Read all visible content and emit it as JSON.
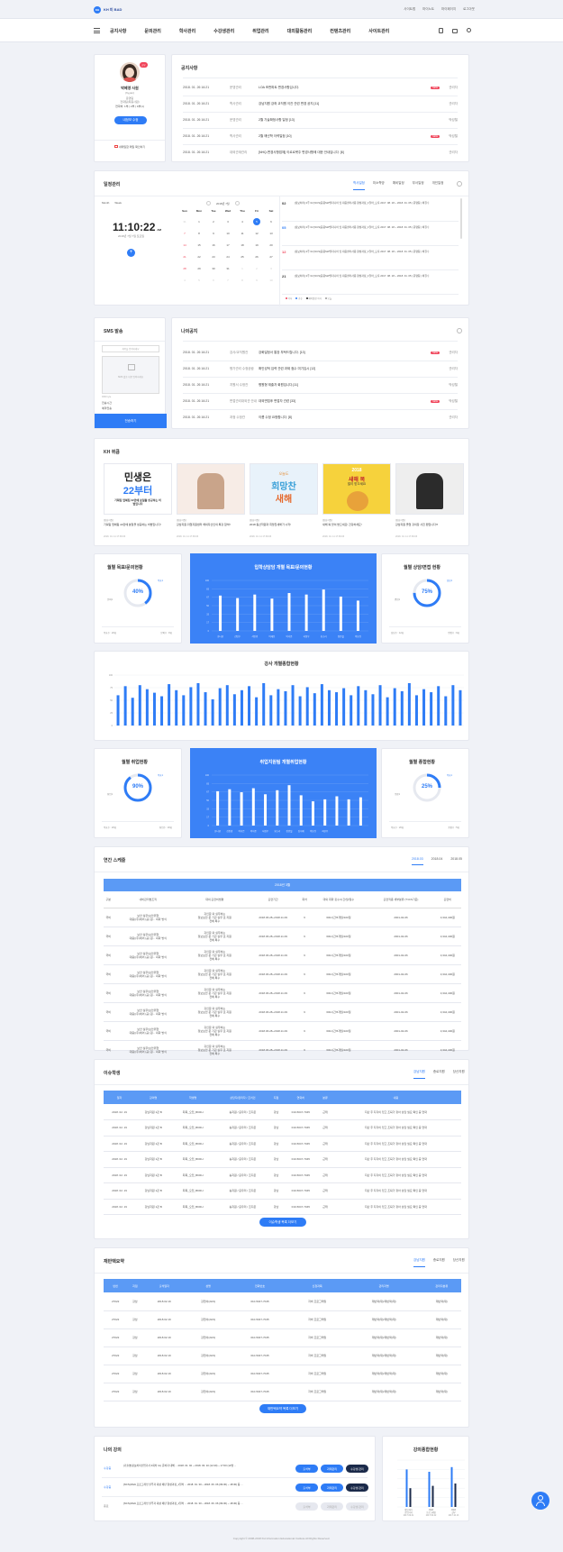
{
  "header": {
    "logo_mark": "KH",
    "logo_text": "KH 미 BAD",
    "links": [
      "사이트맵",
      "마이노트",
      "마이페이지",
      "로그아웃"
    ]
  },
  "nav": {
    "items": [
      "공지사항",
      "문의관리",
      "학사관리",
      "수강생관리",
      "취업관리",
      "대외활동관리",
      "컨텐츠관리",
      "사이트관리"
    ]
  },
  "profile": {
    "badge": "교무",
    "name": "박혜영 사원",
    "id": "(hyyan)",
    "dept": "운영팀",
    "sub": "전략팀(최종사원)",
    "phone": "연락처: 1부 | 2부 | 3부(1)",
    "button": "내정보 수정",
    "footer": "내메일함 메일 확인하기"
  },
  "notice": {
    "title": "공지사항",
    "rows": [
      {
        "date": "2018. 01. 26 16:21",
        "cat": "운영관리",
        "text": "LOA 조판파트 변경사항입니다.",
        "new": true,
        "by": "관리자"
      },
      {
        "date": "2018. 01. 26 16:21",
        "cat": "학사관리",
        "text": "강남지원 강좌 교직원 이관 관련 변경 공지 [11]",
        "new": false,
        "by": "관리자"
      },
      {
        "date": "2018. 01. 26 16:21",
        "cat": "운영관리",
        "text": "2월 기술확정사항 일정 [13]",
        "new": false,
        "by": "박성철"
      },
      {
        "date": "2018. 01. 26 16:21",
        "cat": "학사관리",
        "text": "2월 매년학 이력일정 [10]",
        "new": true,
        "by": "박성철"
      },
      {
        "date": "2018. 01. 26 16:21",
        "cat": "대외관계관리",
        "text": "[NHQ-변경사항업체] 이르르렛주 변경사항에 대한 안내입니다. [6]",
        "new": false,
        "by": "관리자"
      }
    ]
  },
  "schedule": {
    "title": "일정관리",
    "tabs": [
      "학사일정",
      "미소학방",
      "예비일정",
      "부서일정",
      "개인일정"
    ],
    "view_month": "Month",
    "view_week": "Week",
    "time": "11:10:22",
    "ampm": "AM",
    "date": "2018년 7월 7일 토요일",
    "month_label": "2018년 7월",
    "days": [
      "Sun",
      "Mon",
      "Tue",
      "Wed",
      "Thu",
      "Fri",
      "Sat"
    ],
    "cal": [
      [
        "",
        "1",
        "",
        "",
        "",
        "",
        ""
      ],
      [
        "",
        "",
        "",
        "",
        "",
        "",
        ""
      ]
    ],
    "events": [
      {
        "day": "02",
        "text": "[정보처리] 2주 02 [NCS]응용SW엔지니어 및 대응센터사용 양성과정_1일차_오후 2017. 08. 18 ~ 2018. 01. 05 | 운영팀 | 박길수"
      },
      {
        "day": "05",
        "text": "[정보처리] 2주 02 [NCS]응용SW엔지니어 및 대응센터사용 양성과정_1일차_오후 2017. 08. 18 ~ 2018. 01. 05 | 운영팀 | 박길수"
      },
      {
        "day": "12",
        "text": "[정보처리] 2주 02 [NCS]응용SW엔지니어 및 대응센터사용 양성과정_1일차_오후 2017. 08. 18 ~ 2018. 01. 05 | 운영팀 | 박길수"
      },
      {
        "day": "21",
        "text": "[정보처리] 2주 02 [NCS]응용SW엔지니어 및 대응센터사용 양성과정_1일차_오후 2017. 08. 18 ~ 2018. 01. 05 | 운영팀 | 박길수"
      }
    ],
    "legend": [
      "학사",
      "공휴",
      "예비일정 학사",
      "오늘"
    ]
  },
  "sms": {
    "title": "SMS 발송",
    "placeholder": "제목을 입력하세요",
    "body_hint": "SMS 발송 내용 입력하세요",
    "count": "0/80 byte",
    "option1": "전송시간",
    "option2": "예약전송",
    "button": "전송하기"
  },
  "mynotice": {
    "title": "나의공지",
    "rows": [
      {
        "date": "2018. 01. 26 16:21",
        "cat": "강사/교직원관",
        "text": "강화일정서 통장 부탁드립니다. [13]",
        "new": true,
        "by": "관리자"
      },
      {
        "date": "2018. 01. 26 16:21",
        "cat": "평가관리 수정공람",
        "text": "확인성적 입력 관련 과제 점수 미기입시 [12]",
        "new": false,
        "by": "관리자"
      },
      {
        "date": "2018. 01. 26 16:21",
        "cat": "지원서 수정관",
        "text": "병원형 재출자 회원입니다.[11]",
        "new": false,
        "by": "박성철"
      },
      {
        "date": "2018. 01. 26 16:21",
        "cat": "면접관리대외관 안내",
        "text": "대외면접후 면접자 관련 [33]",
        "new": true,
        "by": "박성철"
      },
      {
        "date": "2018. 01. 26 16:21",
        "cat": "과정 수정관",
        "text": "이름 수정 요청합니다. [8]",
        "new": false,
        "by": "관리자"
      }
    ]
  },
  "kh": {
    "title": "KH 퀴큼",
    "items": [
      {
        "img_line1": "민생은",
        "img_line2": "22부터",
        "img_sub": "기획팀 업체팀 22만에 분일들 성공하는 비법입니다",
        "cat": "[강남지원]",
        "text": "기획팀 업체팀 22만에 분일을 성공하는 비법입니다!",
        "date": "2018. 01. 11 17:36:03"
      },
      {
        "cat": "[강남지원]",
        "text": "강남지원 취업지원센터 해외자산인의 특강 참석!!",
        "date": "2018. 01. 11 17:36:03"
      },
      {
        "img_line1": "오늘도",
        "img_line2": "희망찬",
        "img_line3": "새해",
        "cat": "[강남지원]",
        "text": "2018 동산학원과 희망찬새해가 시작!",
        "date": "2018. 01. 11 17:36:03"
      },
      {
        "img_line1": "2018",
        "img_line2": "새해 복",
        "img_line3": "많이 받으세요",
        "cat": "[강남지원]",
        "text": "새해 복 많이 받으세요! 건강하세요!",
        "date": "2018. 01. 11 17:36:03"
      },
      {
        "cat": "[강남지원]",
        "text": "강남지원 졸업 강의장 사진 팬입니다!!!",
        "date": "2018. 01. 11 17:36:03"
      }
    ]
  },
  "stats1": {
    "left": {
      "title": "월별 목표/문의현황",
      "pct": 40,
      "pct_text": "40%",
      "a": "목표1",
      "b": "문의1",
      "foot_l": "목표수 : 20회",
      "foot_r": "문의수 : 8회"
    },
    "center": {
      "title": "입학상담담 개별 목표/문의현황",
      "cats": [
        "송나현",
        "김민수",
        "서민영",
        "이예진",
        "박서준",
        "허정우",
        "홍소리",
        "정민철",
        "이유진"
      ],
      "values": [
        70,
        65,
        72,
        64,
        75,
        72,
        82,
        68,
        60
      ]
    },
    "right": {
      "title": "월별 상담/면접 현황",
      "pct": 75,
      "pct_text": "75%",
      "a": "상담1",
      "b": "면접1",
      "foot_l": "상담수 : 12회",
      "foot_r": "면접수 : 9회"
    }
  },
  "teacher": {
    "title": "강사 개별종합현황",
    "values": [
      60,
      78,
      55,
      80,
      72,
      65,
      58,
      82,
      70,
      60,
      76,
      84,
      66,
      52,
      74,
      80,
      62,
      70,
      78,
      56,
      84,
      60,
      72,
      68,
      80,
      58,
      76,
      64,
      82,
      70,
      66,
      74,
      60,
      78,
      70,
      62,
      80,
      56,
      74,
      68,
      84,
      60,
      72,
      66,
      78,
      58,
      80,
      70
    ]
  },
  "stats2": {
    "left": {
      "title": "월별 취업현황",
      "pct": 90,
      "pct_text": "90%",
      "a": "목표1",
      "b": "취업1",
      "foot_l": "목표수 : 20회",
      "foot_r": "취업수 : 18회"
    },
    "center": {
      "title": "취업지원팀 개별취업현황",
      "cats": [
        "유나현",
        "김민경",
        "이지은",
        "박서준",
        "허정우",
        "홍소리",
        "정민철",
        "김지혜",
        "이유진",
        "최현우"
      ],
      "values": [
        68,
        72,
        66,
        74,
        62,
        70,
        80,
        60,
        48,
        52,
        58,
        52,
        56
      ]
    },
    "right": {
      "title": "월별 종합현황",
      "pct": 25,
      "pct_text": "25%",
      "a": "목표1",
      "b": "종합1",
      "foot_l": "목표수 : 20회",
      "foot_r": "종합수 : 5회"
    }
  },
  "yearly": {
    "title": "연간 스케줄",
    "tabs": [
      "2018.03",
      "2018.04",
      "2018.05"
    ],
    "band": "2018년 3월",
    "headers": [
      "구분",
      "내비관리법조직",
      "대외 훈련비법평",
      "훈련기간",
      "회차",
      "대외 회화 횟수/시간/월/일수",
      "훈련직종 세부분류 (*NCS기준)",
      "훈련비"
    ],
    "rows": [
      [
        "국비",
        "보안 실무(보안위협\n대응)(주)에어 (공) 원...  외화 방식",
        "귀인문 외 실무처는\n정보보안 문 기관 실무 로 지원\n전체 특수",
        "2018.06.28~2018.11.09",
        "6",
        "600시간/5개월/100일",
        "2001-02-06",
        "3,344,400원"
      ],
      [
        "국비",
        "보안 실무(보안위협\n대응)(주)에어 (공) 원...  외화 방식",
        "귀인문 외 실무처는\n정보보안 문 기관 실무 로 지원\n전체 특수",
        "2018.06.28~2018.11.09",
        "6",
        "600시간/5개월/100일",
        "2001-02-06",
        "3,344,400원"
      ],
      [
        "국비",
        "보안 실무(보안위협\n대응)(주)에어 (공) 원...  외화 방식",
        "귀인문 외 실무처는\n정보보안 문 기관 실무 로 지원\n전체 특수",
        "2018.06.28~2018.11.09",
        "6",
        "600시간/5개월/100일",
        "2001-02-06",
        "3,344,400원"
      ],
      [
        "국비",
        "보안 실무(보안위협\n대응)(주)에어 (공) 원...  외화 방식",
        "귀인문 외 실무처는\n정보보안 문 기관 실무 로 지원\n전체 특수",
        "2018.06.28~2018.11.09",
        "6",
        "600시간/5개월/100일",
        "2001-02-06",
        "3,344,400원"
      ],
      [
        "국비",
        "보안 실무(보안위협\n대응)(주)에어 (공) 원...  외화 방식",
        "귀인문 외 실무처는\n정보보안 문 기관 실무 로 지원\n전체 특수",
        "2018.06.28~2018.11.09",
        "6",
        "600시간/5개월/100일",
        "2001-02-06",
        "3,344,400원"
      ],
      [
        "국비",
        "보안 실무(보안위협\n대응)(주)에어 (공) 원...  외화 방식",
        "귀인문 외 실무처는\n정보보안 문 기관 실무 로 지원\n전체 특수",
        "2018.06.28~2018.11.09",
        "6",
        "600시간/5개월/100일",
        "2001-02-06",
        "3,344,400원"
      ],
      [
        "국비",
        "보안 실무(보안위협\n대응)(주)에어 (공) 원...  외화 방식",
        "귀인문 외 실무처는\n정보보안 문 기관 실무 로 지원\n전체 특수",
        "2018.06.28~2018.11.09",
        "6",
        "600시간/5개월/100일",
        "2001-02-06",
        "3,344,400원"
      ],
      [
        "국비",
        "보안 실무(보안위협\n대응)(주)에어 (공) 원...  외화 방식",
        "귀인문 외 실무처는\n정보보안 문 기관 실무 로 지원\n전체 특수",
        "2018.06.28~2018.11.09",
        "6",
        "600시간/5개월/100일",
        "2001-02-06",
        "3,344,400원"
      ]
    ]
  },
  "issue": {
    "title": "이슈학생",
    "tabs": [
      "강남지원",
      "종로지원",
      "당산지원"
    ],
    "headers": [
      "일자",
      "강의명",
      "학생명",
      "상담자/관리자 / 조치인",
      "지점",
      "연락처",
      "분류",
      "내용"
    ],
    "rows": [
      [
        "2018. 02. 19",
        "강남지원 1관 B",
        "최목_오전_BKRH",
        "송지원 / 윤우리 / 조지은",
        "강남",
        "010-5047-7045",
        "근태",
        "지난 주 지각이 있고 조퇴가 잦아 상담 필요 확인 중 연락"
      ],
      [
        "2018. 02. 19",
        "강남지원 1관 B",
        "최목_오전_BKRH",
        "송지원 / 윤우리 / 조지은",
        "강남",
        "010-5047-7045",
        "근태",
        "지난 주 지각이 있고 조퇴가 잦아 상담 필요 확인 중 연락"
      ],
      [
        "2018. 02. 19",
        "강남지원 1관 B",
        "최목_오전_BKRH",
        "송지원 / 윤우리 / 조지은",
        "강남",
        "010-5047-7045",
        "근태",
        "지난 주 지각이 있고 조퇴가 잦아 상담 필요 확인 중 연락"
      ],
      [
        "2018. 02. 19",
        "강남지원 1관 B",
        "최목_오전_BKRH",
        "송지원 / 윤우리 / 조지은",
        "강남",
        "010-5047-7045",
        "근태",
        "지난 주 지각이 있고 조퇴가 잦아 상담 필요 확인 중 연락"
      ],
      [
        "2018. 02. 19",
        "강남지원 1관 B",
        "최목_오전_BKRH",
        "송지원 / 윤우리 / 조지은",
        "강남",
        "010-5047-7045",
        "근태",
        "지난 주 지각이 있고 조퇴가 잦아 상담 필요 확인 중 연락"
      ],
      [
        "2018. 02. 19",
        "강남지원 1관 B",
        "최목_오전_BKRH",
        "송지원 / 윤우리 / 조지은",
        "강남",
        "010-5047-7045",
        "근태",
        "지난 주 지각이 있고 조퇴가 잦아 상담 필요 확인 중 연락"
      ],
      [
        "2018. 02. 19",
        "강남지원 1관 B",
        "최목_오전_BKRH",
        "송지원 / 윤우리 / 조지은",
        "강남",
        "010-5047-7045",
        "근태",
        "지난 주 지각이 있고 조퇴가 잦아 상담 필요 확인 중 연락"
      ]
    ],
    "button": "이슈학생 목록 더보기"
  },
  "reenroll": {
    "title": "재반택요약",
    "tabs": [
      "강남지원",
      "종로지원",
      "당산지원"
    ],
    "headers": [
      "반번",
      "지점",
      "출석일자",
      "성명",
      "전화번호",
      "신청과목",
      "관리자명",
      "관리자분류"
    ],
    "rows": [
      [
        "27022",
        "강남",
        "2018.02.19",
        "강현서(2HS)",
        "010-5047-7045",
        "자바 프로그래밍",
        "재반택(재)/재반택(재)",
        "재반택(재)"
      ],
      [
        "27022",
        "강남",
        "2018.02.19",
        "강현서(2HS)",
        "010-5047-7045",
        "자바 프로그래밍",
        "재반택(재)/재반택(재)",
        "재반택(재)"
      ],
      [
        "27022",
        "강남",
        "2018.02.19",
        "강현서(2HS)",
        "010-5047-7045",
        "자바 프로그래밍",
        "재반택(재)/재반택(재)",
        "재반택(재)"
      ],
      [
        "27022",
        "강남",
        "2018.02.19",
        "강현서(2HS)",
        "010-5047-7045",
        "자바 프로그래밍",
        "재반택(재)/재반택(재)",
        "재반택(재)"
      ],
      [
        "27022",
        "강남",
        "2018.02.19",
        "강현서(2HS)",
        "010-5047-7045",
        "자바 프로그래밍",
        "재반택(재)/재반택(재)",
        "재반택(재)"
      ],
      [
        "27022",
        "강남",
        "2018.02.19",
        "강현서(2HS)",
        "010-5047-7045",
        "자바 프로그래밍",
        "재반택(재)/재반택(재)",
        "재반택(재)"
      ]
    ],
    "button": "재반택요약 목록 더보기"
  },
  "mylecture": {
    "title": "나의 강의",
    "rows": [
      {
        "tag": "수강중",
        "text": "[기술명]정보처리산업기사 4회차 4시 준비자 대해 ... 2018. 01. 02 ~ 2018. 03. 10 (12:40) ~ 17:00 (12명 ...",
        "b1": "출석부",
        "b2": "과제관리",
        "b3": "수강생 관리"
      },
      {
        "tag": "수강중",
        "text": "[NCS]JAVA 프로그래밍 실무자 대상 매년 양성과정_1일차 ... 2018. 01. 30 ~ 2018. 06. 06 (09:30) ~ 18:30) 등 ...",
        "b1": "출석부",
        "b2": "과제관리",
        "b3": "수강생 관리"
      },
      {
        "tag": "종료",
        "text": "[NCS]JAVA 프로그래밍 실무자 대상 매년 양성과정_1일차 ... 2018. 01. 30 ~ 2018. 06. 06 (09:30) ~ 18:30) 등 ...",
        "b1": "출석부",
        "b2": "과제관리",
        "b3": "수강생 관리"
      }
    ]
  },
  "lecstat": {
    "title": "강의종합현황",
    "cats": [
      "정보처리\n산업기사",
      "JAVA\n프로그래밍",
      "JAVA\n실무"
    ],
    "dates": [
      "2017.09.01",
      "2017.09.22",
      "2017.10.13"
    ],
    "values": [
      [
        80,
        40
      ],
      [
        75,
        45
      ],
      [
        85,
        50
      ]
    ]
  },
  "footer": "Copyright © 2008-2018 KH Information Educational Institute All Rights Reserved.",
  "colors": {
    "accent": "#2e7cf6",
    "panel_blue": "#3b82f6",
    "new_badge": "#f0445a"
  }
}
